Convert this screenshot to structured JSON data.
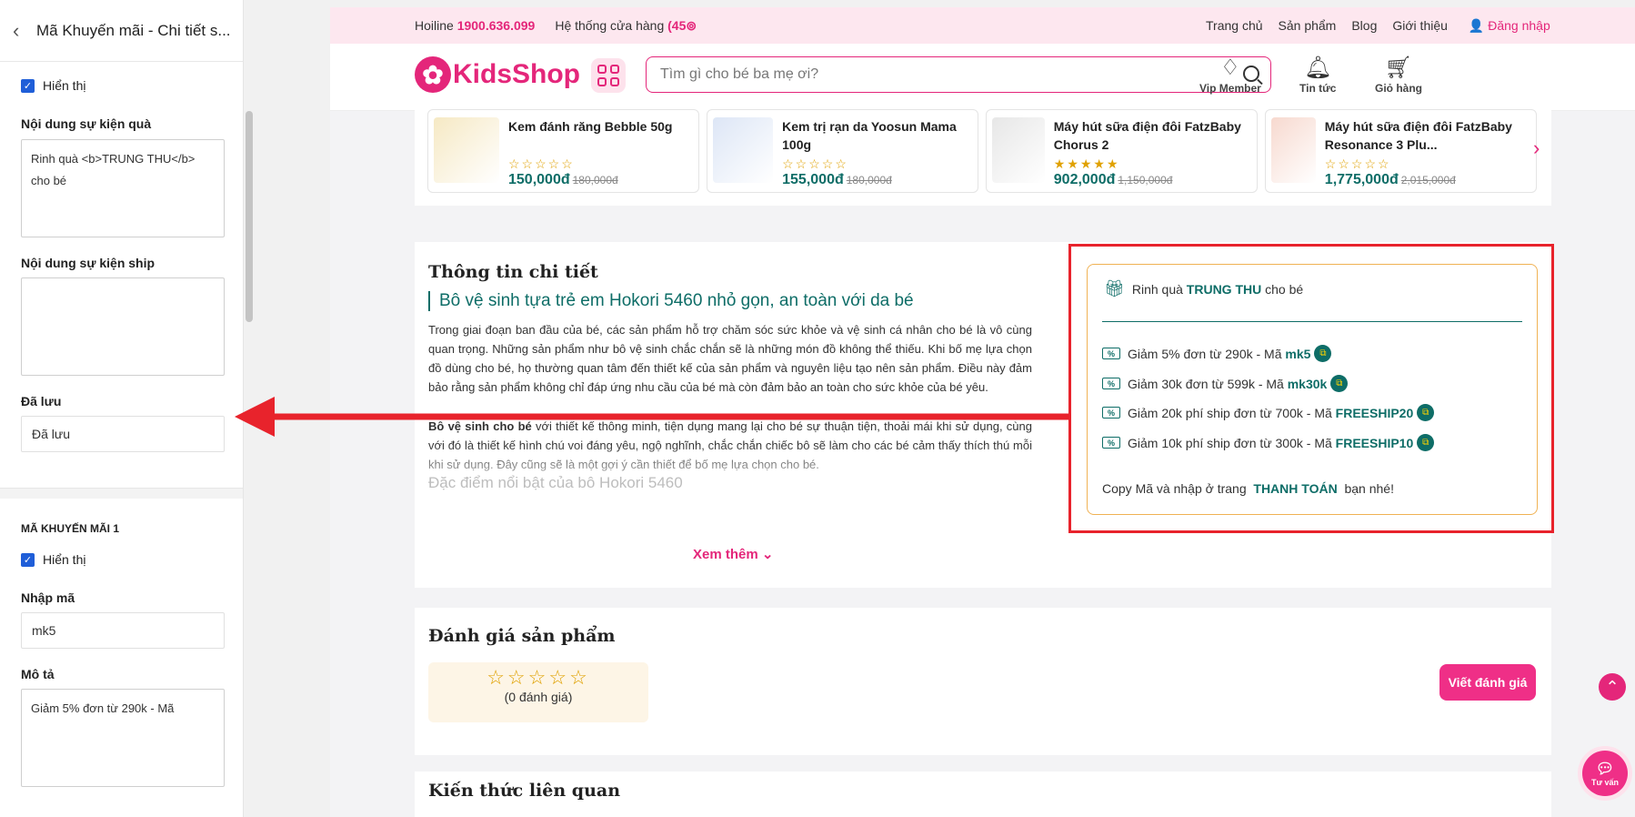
{
  "left_panel": {
    "title": "Mã Khuyến mãi - Chi tiết s...",
    "show_label_1": "Hiển thị",
    "gift_event_label": "Nội dung sự kiện quà",
    "gift_event_value": "Rinh quà <b>TRUNG THU</b> cho bé",
    "ship_event_label": "Nội dung sự kiện ship",
    "ship_event_value": "",
    "saved_label": "Đã lưu",
    "saved_value": "Đã lưu",
    "promo_section": "MÃ KHUYẾN MÃI 1",
    "show_label_2": "Hiển thị",
    "code_label": "Nhập mã",
    "code_value": "mk5",
    "desc_label": "Mô tả",
    "desc_value": "Giảm 5% đơn từ 290k - Mã"
  },
  "topbar": {
    "hotline_label": "Hoiline",
    "hotline_number": "1900.636.099",
    "stores_label": "Hệ thống cửa hàng",
    "stores_count": "(45",
    "nav": [
      "Trang chủ",
      "Sản phẩm",
      "Blog",
      "Giới thiệu",
      "Đăng nhập"
    ]
  },
  "header": {
    "logo": "KidsShop",
    "search_placeholder": "Tìm gì cho bé ba mẹ ơi?",
    "icons": [
      {
        "label": "Vip Member",
        "icon": "diamond-icon"
      },
      {
        "label": "Tin tức",
        "icon": "bell-icon"
      },
      {
        "label": "Giỏ hàng",
        "icon": "cart-icon"
      }
    ]
  },
  "products": [
    {
      "name": "Kem đánh răng Bebble 50g",
      "stars": "☆☆☆☆☆",
      "price": "150,000đ",
      "old_price": "180,000đ"
    },
    {
      "name": "Kem trị rạn da Yoosun Mama 100g",
      "stars": "☆☆☆☆☆",
      "price": "155,000đ",
      "old_price": "180,000đ"
    },
    {
      "name": "Máy hút sữa điện đôi FatzBaby Chorus 2",
      "stars": "★★★★★",
      "price": "902,000đ",
      "old_price": "1,150,000đ"
    },
    {
      "name": "Máy hút sữa điện đôi FatzBaby Resonance 3 Plu...",
      "stars": "☆☆☆☆☆",
      "price": "1,775,000đ",
      "old_price": "2,015,000đ"
    }
  ],
  "detail": {
    "title": "Thông tin chi tiết",
    "subtitle": "Bô vệ sinh tựa trẻ em Hokori 5460 nhỏ gọn, an toàn với da bé",
    "para1": "Trong giai đoạn ban đầu của bé, các sản phẩm hỗ trợ chăm sóc sức khỏe và vệ sinh cá nhân cho bé là vô cùng quan trọng. Những sản phẩm như bô vệ sinh chắc chắn sẽ là những món đồ không thể thiếu. Khi bố mẹ lựa chọn đồ dùng cho bé, họ thường quan tâm đến thiết kế của sản phẩm và nguyên liệu tạo nên sản phẩm. Điều này đảm bảo rằng sản phẩm không chỉ đáp ứng nhu cầu của bé mà còn đảm bảo an toàn cho sức khỏe của bé yêu.",
    "para2_bold": "Bô vệ sinh cho bé",
    "para2": " với thiết kế thông minh, tiện dụng mang lại cho bé sự thuận tiện, thoải mái khi sử dụng, cùng với đó là thiết kế hình chú voi đáng yêu, ngộ nghĩnh, chắc chắn chiếc bô sẽ làm cho các bé cảm thấy thích thú mỗi khi sử dụng. Đây cũng sẽ là một gợi ý cần thiết để bố mẹ lựa chọn cho bé.",
    "more_heading": "Đặc điểm nổi bật của bô Hokori 5460",
    "see_more": "Xem thêm"
  },
  "promo": {
    "head_prefix": "Rinh quà ",
    "head_bold": "TRUNG THU",
    "head_suffix": " cho bé",
    "rows": [
      {
        "text": "Giảm 5% đơn từ 290k - Mã ",
        "code": "mk5"
      },
      {
        "text": "Giảm 30k đơn từ 599k - Mã ",
        "code": "mk30k"
      },
      {
        "text": "Giảm 20k phí ship đơn từ 700k - Mã ",
        "code": "FREESHIP20"
      },
      {
        "text": "Giảm 10k phí ship đơn từ 300k - Mã ",
        "code": "FREESHIP10"
      }
    ],
    "foot_prefix": "Copy Mã và nhập ở trang ",
    "foot_bold": "THANH TOÁN",
    "foot_suffix": " bạn nhé!"
  },
  "review": {
    "title": "Đánh giá sản phẩm",
    "stars": "☆☆☆☆☆",
    "count": "(0 đánh giá)",
    "write_button": "Viết đánh giá"
  },
  "related": {
    "title": "Kiến thức liên quan"
  },
  "advise_label": "Tư vấn",
  "colors": {
    "brand_pink": "#e4267a",
    "teal": "#0e6d67",
    "highlight_red": "#e8232c"
  }
}
